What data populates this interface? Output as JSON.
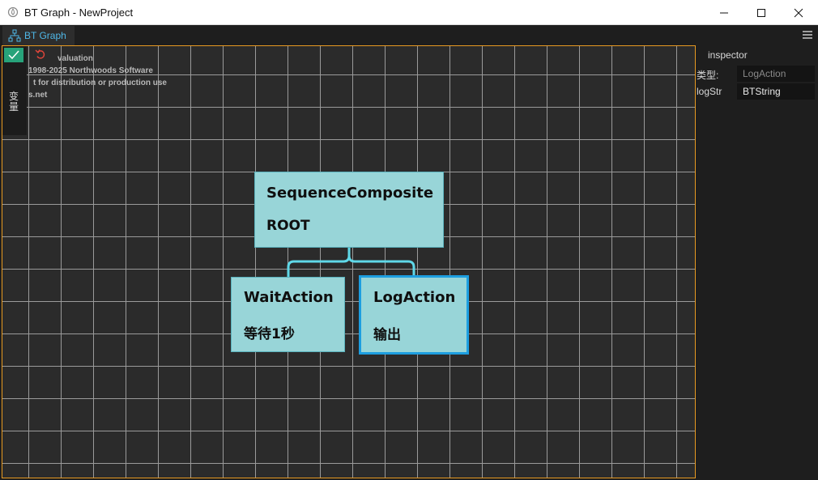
{
  "window": {
    "title": "BT Graph - NewProject"
  },
  "tab": {
    "label": "BT Graph",
    "icon": "hierarchy-icon"
  },
  "toolbar": {
    "variables_label": "变量"
  },
  "watermark": {
    "lines": [
      "valuation",
      "1998-2025 Northwoods Software",
      "t for distribution or production use",
      "s.net"
    ]
  },
  "graph": {
    "nodes": [
      {
        "type": "SequenceComposite",
        "name": "ROOT"
      },
      {
        "type": "WaitAction",
        "name": "等待1秒"
      },
      {
        "type": "LogAction",
        "name": "输出",
        "selected": true
      }
    ]
  },
  "inspector": {
    "title": "inspector",
    "fields": [
      {
        "label": "类型:",
        "value": "LogAction"
      },
      {
        "label": "logStr",
        "value": "BTString"
      }
    ]
  },
  "colors": {
    "accent": "#4fb8e8",
    "node_fill": "#98d5d8",
    "selected_border": "#1d9ee0",
    "graph_border": "#e89a21",
    "confirm_button": "#27a37a",
    "link": "#5fd8e8"
  }
}
